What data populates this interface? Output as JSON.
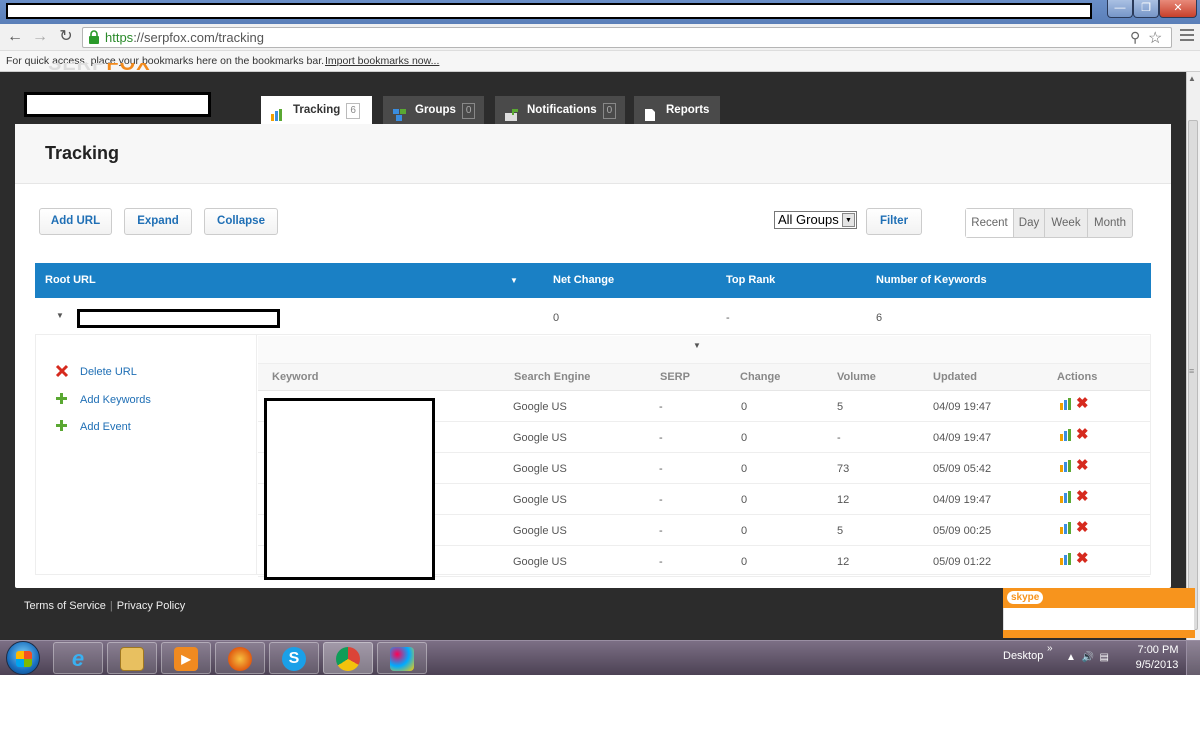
{
  "browser": {
    "url_scheme": "https",
    "url_rest": "://serpfox.com/tracking",
    "bookmarks_hint": "For quick access, place your bookmarks here on the bookmarks bar.",
    "import_link": "Import bookmarks now..."
  },
  "logo": {
    "part1": "SERP",
    "part2": "FOX"
  },
  "nav_tabs": [
    {
      "label": "Tracking",
      "badge": "6"
    },
    {
      "label": "Groups",
      "badge": "0"
    },
    {
      "label": "Notifications",
      "badge": "0"
    },
    {
      "label": "Reports"
    }
  ],
  "page": {
    "title": "Tracking"
  },
  "toolbar": {
    "add_url": "Add URL",
    "expand": "Expand",
    "collapse": "Collapse",
    "group_select": "All Groups",
    "filter": "Filter",
    "ranges": [
      "Recent",
      "Day",
      "Week",
      "Month"
    ],
    "selected_range": "Recent"
  },
  "table": {
    "headers": [
      "Root URL",
      "Net Change",
      "Top Rank",
      "Number of Keywords"
    ],
    "root_row": {
      "net_change": "0",
      "top_rank": "-",
      "keywords": "6"
    }
  },
  "side_actions": [
    {
      "icon": "delete-icon",
      "label": "Delete URL"
    },
    {
      "icon": "plus-icon",
      "label": "Add Keywords"
    },
    {
      "icon": "plus-icon",
      "label": "Add Event"
    }
  ],
  "keyword_table": {
    "headers": [
      "Keyword",
      "Search Engine",
      "SERP",
      "Change",
      "Volume",
      "Updated",
      "Actions"
    ],
    "rows": [
      {
        "engine": "Google US",
        "serp": "-",
        "change": "0",
        "volume": "5",
        "updated": "04/09 19:47"
      },
      {
        "engine": "Google US",
        "serp": "-",
        "change": "0",
        "volume": "-",
        "updated": "04/09 19:47"
      },
      {
        "engine": "Google US",
        "serp": "-",
        "change": "0",
        "volume": "73",
        "updated": "05/09 05:42"
      },
      {
        "engine": "Google US",
        "serp": "-",
        "change": "0",
        "volume": "12",
        "updated": "04/09 19:47"
      },
      {
        "engine": "Google US",
        "serp": "-",
        "change": "0",
        "volume": "5",
        "updated": "05/09 00:25"
      },
      {
        "engine": "Google US",
        "serp": "-",
        "change": "0",
        "volume": "12",
        "updated": "05/09 01:22"
      }
    ]
  },
  "footer": {
    "terms": "Terms of Service",
    "privacy": "Privacy Policy"
  },
  "skype": {
    "label": "skype"
  },
  "taskbar": {
    "desktop_label": "Desktop",
    "time": "7:00 PM",
    "date": "9/5/2013",
    "apps": [
      "ie-icon",
      "explorer-icon",
      "media-player-icon",
      "firefox-icon",
      "skype-icon",
      "chrome-icon",
      "paint-icon"
    ]
  },
  "colors": {
    "accent": "#1a80c5",
    "link": "#1f6fb5",
    "delete": "#d62a1e",
    "add": "#5aa832",
    "brand_orange": "#f28a1c"
  }
}
